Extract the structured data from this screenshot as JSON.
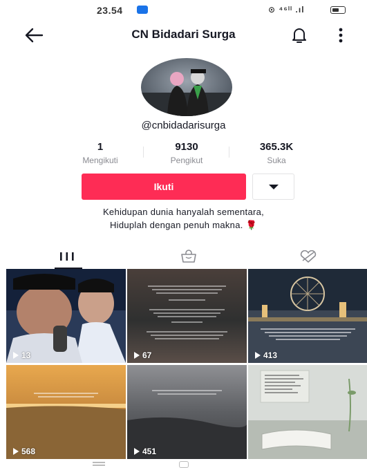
{
  "status_bar": {
    "time": "23.54",
    "indicators": "⊙ ⁴⁶ᴵᴵ .ıl",
    "battery_level": 0.6
  },
  "header": {
    "title": "CN Bidadari Surga"
  },
  "profile": {
    "username": "@cnbidadarisurga",
    "stats": [
      {
        "value": "1",
        "label": "Mengikuti"
      },
      {
        "value": "9130",
        "label": "Pengikut"
      },
      {
        "value": "365.3K",
        "label": "Suka"
      }
    ],
    "follow_label": "Ikuti",
    "bio_line1": "Kehidupan dunia hanyalah sementara,",
    "bio_line2": "Hiduplah dengan penuh makna. 🌹"
  },
  "tabs": {
    "active": "videos",
    "items": [
      "videos-tab",
      "shop-tab",
      "liked-tab"
    ]
  },
  "videos": [
    {
      "views": "13"
    },
    {
      "views": "67"
    },
    {
      "views": "413"
    },
    {
      "views": "568"
    },
    {
      "views": "451"
    },
    {
      "views": ""
    }
  ],
  "colors": {
    "accent": "#fe2c55",
    "text": "#161823",
    "muted": "#8a8b91"
  }
}
